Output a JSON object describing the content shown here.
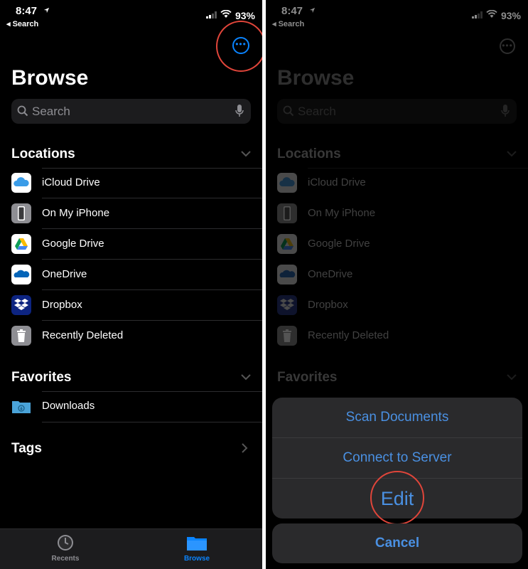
{
  "status": {
    "time": "8:47",
    "back": "◂ Search",
    "battery": "93%"
  },
  "browse": {
    "title": "Browse",
    "search_placeholder": "Search",
    "locations_label": "Locations",
    "locations": [
      {
        "label": "iCloud Drive",
        "icon": "icloud-icon"
      },
      {
        "label": "On My iPhone",
        "icon": "iphone-icon"
      },
      {
        "label": "Google Drive",
        "icon": "google-drive-icon"
      },
      {
        "label": "OneDrive",
        "icon": "onedrive-icon"
      },
      {
        "label": "Dropbox",
        "icon": "dropbox-icon"
      },
      {
        "label": "Recently Deleted",
        "icon": "trash-icon"
      }
    ],
    "favorites_label": "Favorites",
    "favorites": [
      {
        "label": "Downloads",
        "icon": "downloads-folder-icon"
      }
    ],
    "tags_label": "Tags"
  },
  "tabbar": {
    "recents": "Recents",
    "browse": "Browse"
  },
  "action_sheet": {
    "items": [
      "Scan Documents",
      "Connect to Server",
      "Edit"
    ],
    "cancel": "Cancel"
  },
  "colors": {
    "accent": "#0a84ff",
    "sheet_text": "#4a90e2",
    "highlight": "#e0453a"
  }
}
